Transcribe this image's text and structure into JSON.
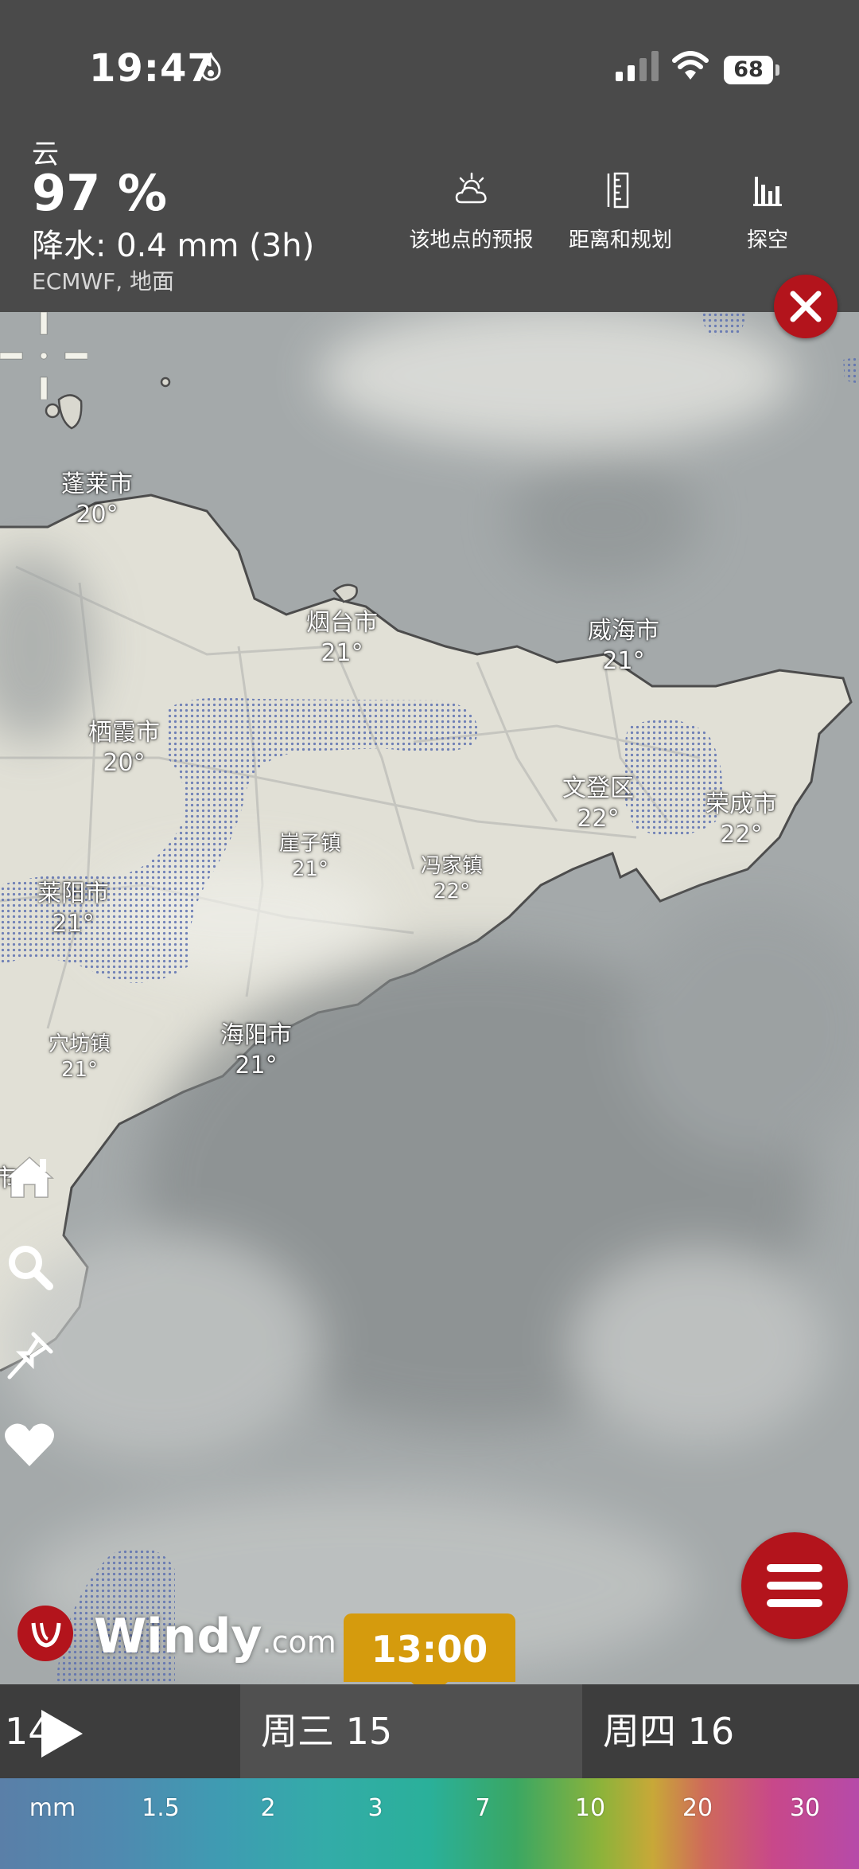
{
  "status_bar": {
    "time": "19:47",
    "battery": "68"
  },
  "header": {
    "layer": "云",
    "value": "97 %",
    "precipitation": "降水: 0.4 mm (3h)",
    "model": "ECMWF, 地面",
    "buttons": [
      {
        "label": "该地点的预报",
        "icon": "cloud-sun-icon"
      },
      {
        "label": "距离和规划",
        "icon": "ruler-icon"
      },
      {
        "label": "探空",
        "icon": "bar-chart-icon"
      }
    ]
  },
  "map": {
    "cities": [
      {
        "name": "蓬莱市",
        "temp": "20°"
      },
      {
        "name": "烟台市",
        "temp": "21°"
      },
      {
        "name": "威海市",
        "temp": "21°"
      },
      {
        "name": "栖霞市",
        "temp": "20°"
      },
      {
        "name": "文登区",
        "temp": "22°"
      },
      {
        "name": "荣成市",
        "temp": "22°"
      },
      {
        "name": "崖子镇",
        "temp": "21°"
      },
      {
        "name": "冯家镇",
        "temp": "22°"
      },
      {
        "name": "莱阳市",
        "temp": "21°"
      },
      {
        "name": "穴坊镇",
        "temp": "21°"
      },
      {
        "name": "海阳市",
        "temp": "21°"
      },
      {
        "name": "市",
        "temp": ""
      }
    ],
    "brand": {
      "name": "Windy",
      "suffix": ".com"
    }
  },
  "timeline": {
    "current_time": "13:00",
    "days": {
      "prev": "14",
      "current": "周三 15",
      "next": "周四 16"
    }
  },
  "legend": {
    "unit": "mm",
    "ticks": [
      "1.5",
      "2",
      "3",
      "7",
      "10",
      "20",
      "30"
    ]
  },
  "colors": {
    "header_bg": "#4a4a4a",
    "accent_red": "#b3141c",
    "time_badge": "#d59b0d"
  }
}
